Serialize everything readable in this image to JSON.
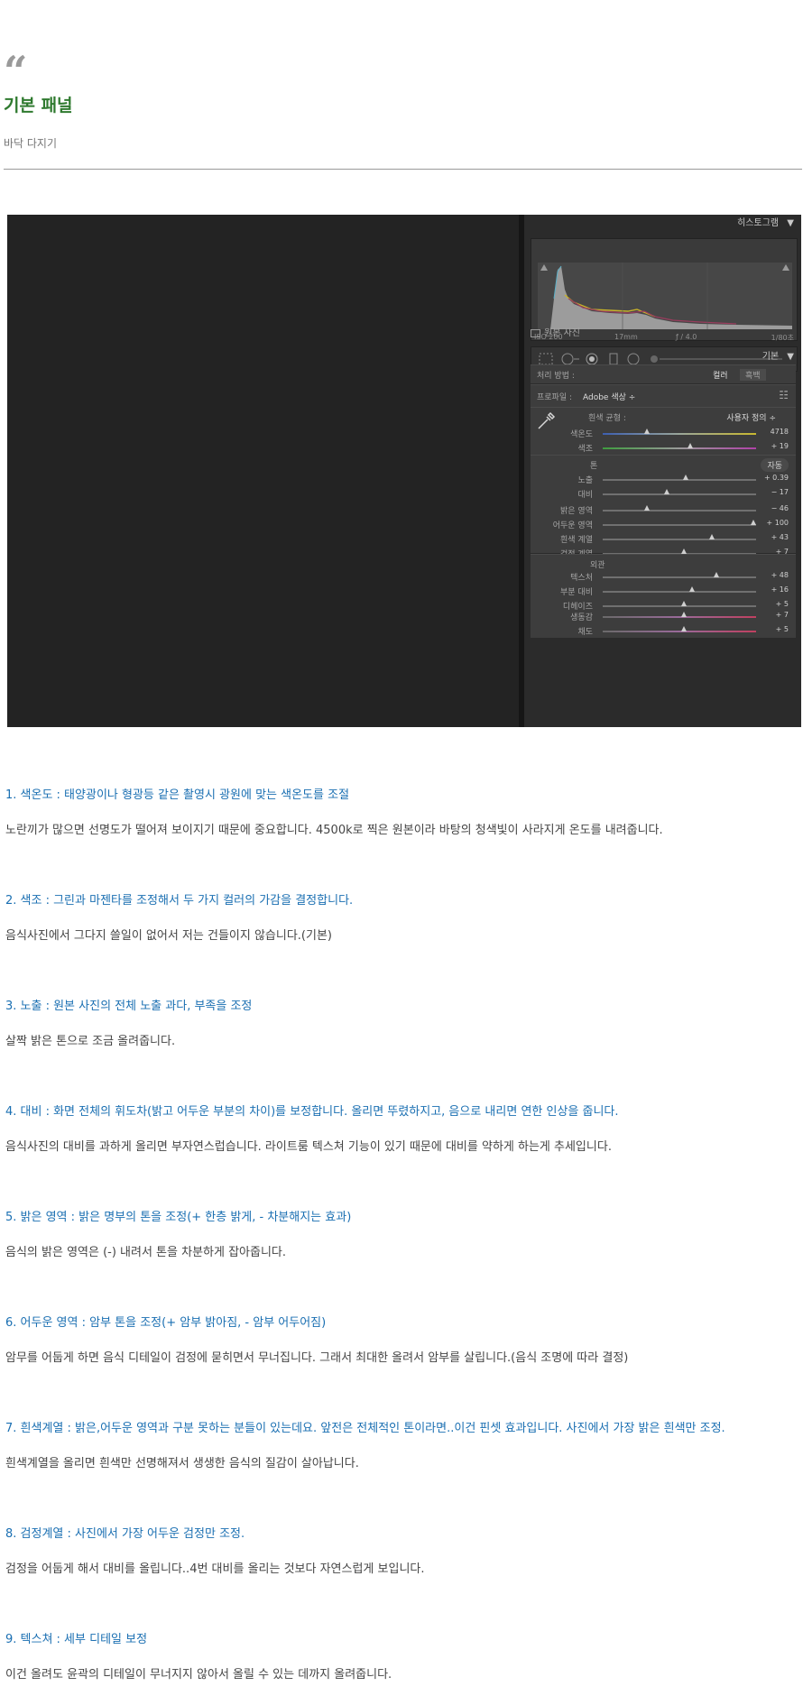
{
  "header": {
    "quote": "“",
    "title": "기본 패널",
    "subtitle": "바닥 다지기"
  },
  "panel": {
    "histogram_label": "히스토그램",
    "histogram_arrow": "▼",
    "meta": {
      "iso": "ISO 200",
      "focal": "17mm",
      "aperture": "ƒ / 4.0",
      "shutter": "1/80초"
    },
    "original_photo_label": "원본 사진",
    "basic_label": "기본",
    "basic_arrow": "▼",
    "treatment_label": "처리 방법 :",
    "treatment_color": "컬러",
    "treatment_bw": "흑백",
    "profile_label": "프로파일 :",
    "profile_value": "Adobe 색상 ÷",
    "grid_icon": "☷",
    "wb_label": "흰색 균형 :",
    "wb_value": "사용자 정의 ÷",
    "tone_label": "톤",
    "auto_label": "자동",
    "presence_label": "외관",
    "sliders_wb": [
      {
        "label": "색온도",
        "value": "4718",
        "position": 0.29
      },
      {
        "label": "색조",
        "value": "+ 19",
        "position": 0.57
      }
    ],
    "sliders_tone1": [
      {
        "label": "노출",
        "value": "+ 0.39",
        "position": 0.54
      },
      {
        "label": "대비",
        "value": "− 17",
        "position": 0.42
      }
    ],
    "sliders_tone2": [
      {
        "label": "밝은 영역",
        "value": "− 46",
        "position": 0.29
      },
      {
        "label": "어두운 영역",
        "value": "+ 100",
        "position": 0.98
      },
      {
        "label": "흰색 계열",
        "value": "+ 43",
        "position": 0.71
      },
      {
        "label": "검정 계열",
        "value": "+ 7",
        "position": 0.53
      }
    ],
    "sliders_presence1": [
      {
        "label": "텍스처",
        "value": "+ 48",
        "position": 0.74
      },
      {
        "label": "부분 대비",
        "value": "+ 16",
        "position": 0.58
      },
      {
        "label": "디헤이즈",
        "value": "+ 5",
        "position": 0.53
      }
    ],
    "sliders_presence2": [
      {
        "label": "생동감",
        "value": "+ 7",
        "position": 0.53
      },
      {
        "label": "채도",
        "value": "+ 5",
        "position": 0.53
      }
    ]
  },
  "items": [
    {
      "heading": "1. 색온도 : 태양광이나 형광등 같은 촬영시 광원에 맞는 색온도를 조절",
      "text": "노란끼가 많으면 선명도가 떨어져 보이지기 때문에 중요합니다. 4500k로 찍은 원본이라 바탕의 청색빛이 사라지게 온도를 내려줍니다."
    },
    {
      "heading": "2. 색조 : 그린과 마젠타를 조정해서 두 가지 컬러의 가감을 결정합니다.",
      "text": "음식사진에서 그다지 쓸일이 없어서 저는 건들이지 않습니다.(기본)"
    },
    {
      "heading": "3. 노출 : 원본 사진의 전체 노출 과다, 부족을 조정",
      "text": "살짝 밝은 톤으로 조금 올려줍니다."
    },
    {
      "heading": "4. 대비 : 화면 전체의 휘도차(밝고 어두운 부분의 차이)를 보정합니다. 올리면 뚜렸하지고, 음으로 내리면 연한 인상을 줍니다.",
      "text": "음식사진의 대비를 과하게 올리면 부자연스럽습니다. 라이트룸 텍스쳐 기능이 있기 때문에 대비를 약하게 하는게 추세입니다."
    },
    {
      "heading": "5. 밝은 영역 : 밝은 명부의 톤을 조정(+ 한층 밝게, - 차분해지는 효과)",
      "text": "음식의 밝은 영역은 (-) 내려서 톤을 차분하게 잡아줍니다."
    },
    {
      "heading": "6. 어두운 영역 : 암부 톤을 조정(+ 암부 밝아짐, - 암부 어두어짐)",
      "text": "암무를 어둡게 하면 음식 디테일이 검정에 묻히면서 무너집니다. 그래서 최대한 올려서 암부를 살립니다.(음식 조명에 따라 결정)"
    },
    {
      "heading": "7. 흰색계열 : 밝은,어두운 영역과 구분 못하는 분들이 있는데요. 앞전은 전체적인 톤이라면..이건 핀셋 효과입니다. 사진에서 가장 밝은 흰색만 조정.",
      "text": "흰색계열을 올리면 흰색만 선명해져서 생생한 음식의 질감이 살아납니다."
    },
    {
      "heading": "8. 검정계열 : 사진에서 가장 어두운 검정만 조정.",
      "text": "검정을 어둡게 해서 대비를 올립니다..4번 대비를 올리는 것보다 자연스럽게 보입니다."
    },
    {
      "heading": "9. 텍스쳐 : 세부 디테일 보정",
      "text": "이건 올려도 윤곽의 디테일이 무너지지 않아서 올릴 수 있는 데까지 올려줍니다."
    }
  ]
}
